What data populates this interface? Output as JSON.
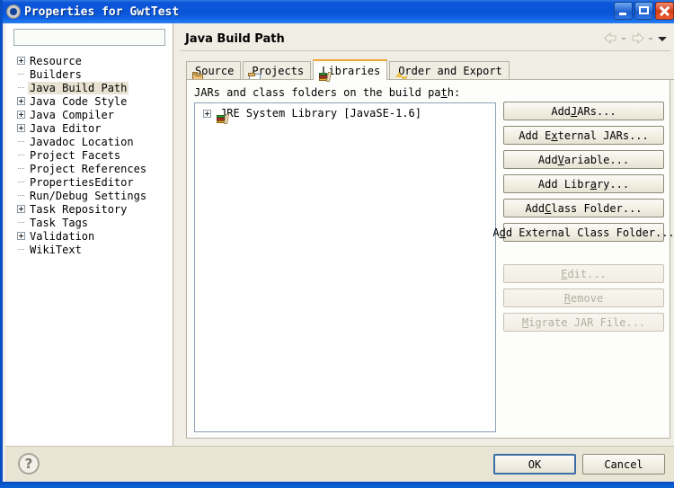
{
  "window": {
    "title": "Properties for GwtTest",
    "icon": "gear-icon",
    "controls": {
      "minimize": "minimize-icon",
      "maximize": "maximize-icon",
      "close": "close-icon"
    }
  },
  "colors": {
    "titlebar_blue": "#0a55d8",
    "dialog_bg": "#f0eee4",
    "footer_bg": "#e9e5d5",
    "pane_bg": "#fdfdfb",
    "active_tab_accent": "#f0a830",
    "selection_bg": "#e8e2d2",
    "default_button_border": "#3a6ea5",
    "disabled_text": "#b4b0a2"
  },
  "sidebar": {
    "filter": {
      "value": "",
      "placeholder": ""
    },
    "items": [
      {
        "label": "Resource",
        "expandable": true,
        "selected": false
      },
      {
        "label": "Builders",
        "expandable": false,
        "selected": false
      },
      {
        "label": "Java Build Path",
        "expandable": false,
        "selected": true
      },
      {
        "label": "Java Code Style",
        "expandable": true,
        "selected": false
      },
      {
        "label": "Java Compiler",
        "expandable": true,
        "selected": false
      },
      {
        "label": "Java Editor",
        "expandable": true,
        "selected": false
      },
      {
        "label": "Javadoc Location",
        "expandable": false,
        "selected": false
      },
      {
        "label": "Project Facets",
        "expandable": false,
        "selected": false
      },
      {
        "label": "Project References",
        "expandable": false,
        "selected": false
      },
      {
        "label": "PropertiesEditor",
        "expandable": false,
        "selected": false
      },
      {
        "label": "Run/Debug Settings",
        "expandable": false,
        "selected": false
      },
      {
        "label": "Task Repository",
        "expandable": true,
        "selected": false
      },
      {
        "label": "Task Tags",
        "expandable": false,
        "selected": false
      },
      {
        "label": "Validation",
        "expandable": true,
        "selected": false
      },
      {
        "label": "WikiText",
        "expandable": false,
        "selected": false
      }
    ]
  },
  "page": {
    "title": "Java Build Path",
    "nav": {
      "back": "back-arrow-icon",
      "back_dropdown": "chevron-down-icon",
      "forward": "forward-arrow-icon",
      "forward_dropdown": "chevron-down-icon",
      "menu": "view-menu-icon"
    }
  },
  "tabs": [
    {
      "label": "Source",
      "icon": "package-icon",
      "active": false
    },
    {
      "label": "Projects",
      "icon": "folder-icon",
      "active": false
    },
    {
      "label": "Libraries",
      "icon": "books-icon",
      "active": true
    },
    {
      "label": "Order and Export",
      "icon": "order-arrows-icon",
      "active": false
    }
  ],
  "libraries_pane": {
    "caption": "JARs and class folders on the build path:",
    "caption_mnemonic": "t",
    "entries": [
      {
        "label": "JRE System Library [JavaSE-1.6]",
        "icon": "library-books-icon",
        "expandable": true
      }
    ],
    "buttons": [
      {
        "label": "Add JARs...",
        "mnemonic": "J",
        "enabled": true,
        "name": "add-jars-button"
      },
      {
        "label": "Add External JARs...",
        "mnemonic": "x",
        "enabled": true,
        "name": "add-external-jars-button"
      },
      {
        "label": "Add Variable...",
        "mnemonic": "V",
        "enabled": true,
        "name": "add-variable-button"
      },
      {
        "label": "Add Library...",
        "mnemonic": "a",
        "enabled": true,
        "name": "add-library-button"
      },
      {
        "label": "Add Class Folder...",
        "mnemonic": "C",
        "enabled": true,
        "name": "add-class-folder-button"
      },
      {
        "label": "Add External Class Folder...",
        "mnemonic": "d",
        "enabled": true,
        "name": "add-external-class-folder-button"
      },
      {
        "label": "Edit...",
        "mnemonic": "E",
        "enabled": false,
        "name": "edit-button"
      },
      {
        "label": "Remove",
        "mnemonic": "R",
        "enabled": false,
        "name": "remove-button"
      },
      {
        "label": "Migrate JAR File...",
        "mnemonic": "M",
        "enabled": false,
        "name": "migrate-jar-file-button"
      }
    ]
  },
  "footer": {
    "help": "?",
    "ok_label": "OK",
    "cancel_label": "Cancel"
  }
}
